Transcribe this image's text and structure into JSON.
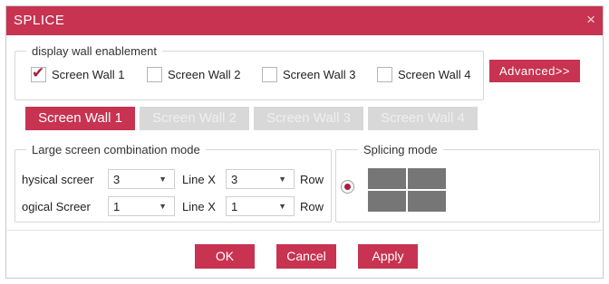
{
  "dialog": {
    "title": "SPLICE",
    "close_glyph": "×"
  },
  "enablement": {
    "legend": "display wall enablement",
    "walls": [
      {
        "label": "Screen Wall 1",
        "checked": true
      },
      {
        "label": "Screen Wall 2",
        "checked": false
      },
      {
        "label": "Screen Wall 3",
        "checked": false
      },
      {
        "label": "Screen Wall 4",
        "checked": false
      }
    ],
    "check_glyph": "✔",
    "advanced_label": "Advanced>>"
  },
  "tabs": [
    {
      "label": "Screen Wall 1",
      "active": true
    },
    {
      "label": "Screen Wall 2",
      "active": false
    },
    {
      "label": "Screen Wall 3",
      "active": false
    },
    {
      "label": "Screen Wall 4",
      "active": false
    }
  ],
  "combination": {
    "legend": "Large screen combination mode",
    "rows": [
      {
        "label": "hysical screer",
        "line_value": "3",
        "line_label": "Line X",
        "row_value": "3",
        "row_label": "Row"
      },
      {
        "label": "ogical Screer",
        "line_value": "1",
        "line_label": "Line X",
        "row_value": "1",
        "row_label": "Row"
      }
    ],
    "dropdown_glyph": "▼"
  },
  "splicing": {
    "legend": "Splicing mode",
    "selected": true,
    "grid": {
      "rows": 2,
      "cols": 2
    }
  },
  "buttons": {
    "ok": "OK",
    "cancel": "Cancel",
    "apply": "Apply"
  },
  "colors": {
    "accent": "#c73351",
    "check": "#a51f3b",
    "inactive_tab": "#d8d8d8",
    "grid_cell": "#767676"
  }
}
